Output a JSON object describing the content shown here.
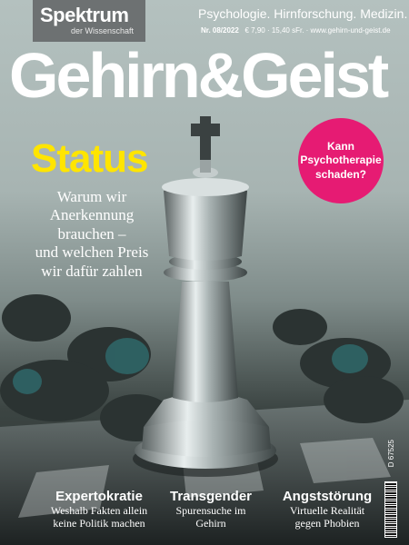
{
  "logo": {
    "main": "Spektrum",
    "sub": "der Wissenschaft"
  },
  "tagline": "Psychologie. Hirnforschung. Medizin.",
  "issue": {
    "number": "Nr. 08/2022",
    "price_url": "€ 7,90 · 15,40 sFr. · www.gehirn-und-geist.de"
  },
  "masthead": "Gehirn&Geist",
  "bubble": "Kann\nPsychotherapie\nschaden?",
  "cover_story": {
    "title": "Status",
    "deck": "Warum wir\nAnerkennung\nbrauchen –\nund welchen Preis\nwir dafür zahlen"
  },
  "topics": [
    {
      "title": "Expertokratie",
      "sub": "Weshalb Fakten allein\nkeine Politik machen"
    },
    {
      "title": "Transgender",
      "sub": "Spurensuche im\nGehirn"
    },
    {
      "title": "Angststörung",
      "sub": "Virtuelle Realität\ngegen Phobien"
    }
  ],
  "barcode_id": "D 67525",
  "colors": {
    "accent_yellow": "#ffe500",
    "accent_pink": "#e61b73",
    "logo_gray": "#6d7172"
  }
}
